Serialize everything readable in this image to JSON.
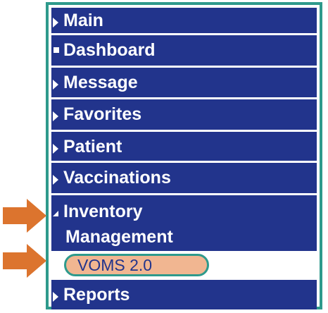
{
  "menu": {
    "items": [
      {
        "label": "Main",
        "icon": "arrow-right-icon"
      },
      {
        "label": "Dashboard",
        "icon": "square-icon"
      },
      {
        "label": "Message",
        "icon": "arrow-right-icon"
      },
      {
        "label": "Favorites",
        "icon": "arrow-right-icon"
      },
      {
        "label": "Patient",
        "icon": "arrow-right-icon"
      },
      {
        "label": "Vaccinations",
        "icon": "arrow-right-icon"
      },
      {
        "label_line1": "Inventory",
        "label_line2": "Management",
        "icon": "arrow-down-left-icon",
        "expanded": true
      },
      {
        "label": "Reports",
        "icon": "arrow-right-icon"
      }
    ],
    "subitems": [
      {
        "label": "VOMS 2.0",
        "highlighted": true
      }
    ]
  },
  "colors": {
    "menu_background": "#22348c",
    "menu_text": "#ffffff",
    "frame_border": "#2e9a8c",
    "pill_fill": "#f1b691",
    "callout_arrow": "#dc742e"
  },
  "annotations": {
    "arrows": [
      "orange-arrow-icon",
      "orange-arrow-icon"
    ]
  }
}
